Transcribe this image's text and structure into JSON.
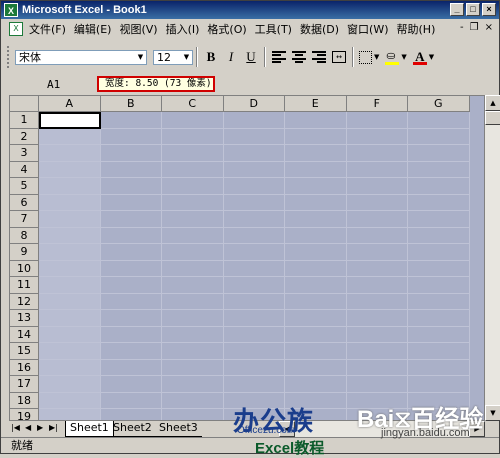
{
  "window": {
    "title": "Microsoft Excel - Book1",
    "minimize": "_",
    "restore": "□",
    "close": "×"
  },
  "menu": {
    "items": [
      "文件(F)",
      "编辑(E)",
      "视图(V)",
      "插入(I)",
      "格式(O)",
      "工具(T)",
      "数据(D)",
      "窗口(W)",
      "帮助(H)"
    ],
    "doc_min": "-",
    "doc_restore": "❐",
    "doc_close": "×"
  },
  "toolbar": {
    "font_name": "宋体",
    "font_size": "12",
    "bold": "B",
    "italic": "I",
    "underline": "U"
  },
  "formula_bar": {
    "name_box": "A1",
    "width_tip": "宽度: 8.50 (73 像素)"
  },
  "grid": {
    "columns": [
      "A",
      "B",
      "C",
      "D",
      "E",
      "F",
      "G"
    ],
    "rows": [
      "1",
      "2",
      "3",
      "4",
      "5",
      "6",
      "7",
      "8",
      "9",
      "10",
      "11",
      "12",
      "13",
      "14",
      "15",
      "16",
      "17",
      "18",
      "19"
    ],
    "selection_color": "#aab0c8"
  },
  "sheets": {
    "tabs": [
      "Sheet1",
      "Sheet2",
      "Sheet3"
    ],
    "nav": [
      "|◀",
      "◀",
      "▶",
      "▶|"
    ]
  },
  "status": {
    "text": "就绪"
  },
  "watermarks": {
    "brand": "办公族",
    "brand_url": "Officezu.com",
    "tutorial": "Excel教程",
    "baidu": "Bai⧖百经验",
    "baidu_url": "jingyan.baidu.com"
  }
}
